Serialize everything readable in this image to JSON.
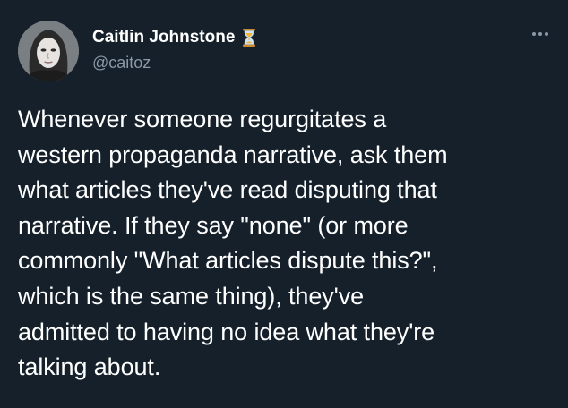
{
  "author": {
    "name": "Caitlin Johnstone",
    "handle": "@caitoz",
    "badge_icon": "hourglass-icon",
    "avatar_icon": "profile-photo"
  },
  "menu": {
    "icon": "more-options-icon"
  },
  "tweet": {
    "lines": [
      "Whenever someone regurgitates a",
      "western propaganda narrative, ask them",
      "what articles they've read disputing that",
      "narrative. If they say \"none\" (or more",
      "commonly \"What articles dispute this?\",",
      "which is the same thing), they've",
      "admitted to having no idea what they're",
      "talking about."
    ]
  },
  "colors": {
    "background": "#15202b",
    "text": "#ffffff",
    "secondary_text": "#8b98a5",
    "badge": "#f5b335"
  }
}
